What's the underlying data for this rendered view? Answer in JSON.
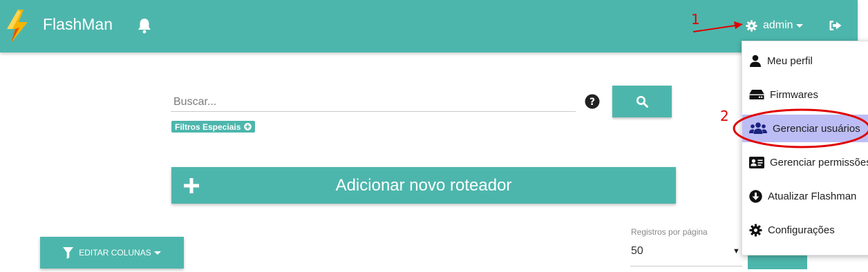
{
  "navbar": {
    "app_name": "FlashMan",
    "user_label": "admin",
    "bg_color": "#4db6ac"
  },
  "annotations": {
    "step1": "1",
    "step2": "2",
    "color": "#e00000"
  },
  "search": {
    "placeholder": "Buscar...",
    "special_filters_label": "Filtros Especiais"
  },
  "actions": {
    "add_router_label": "Adicionar novo roteador",
    "edit_columns_label": "EDITAR COLUNAS"
  },
  "pagination": {
    "per_page_label": "Registros por página",
    "per_page_value": "50"
  },
  "user_dropdown": {
    "items": [
      {
        "label": "Meu perfil",
        "icon": "user-icon"
      },
      {
        "label": "Firmwares",
        "icon": "hdd-icon"
      },
      {
        "label": "Gerenciar usuários",
        "icon": "users-icon",
        "highlighted": true
      },
      {
        "label": "Gerenciar permissões",
        "icon": "id-card-icon"
      },
      {
        "label": "Atualizar Flashman",
        "icon": "arrow-circle-down-icon"
      },
      {
        "label": "Configurações",
        "icon": "gear-icon"
      }
    ]
  }
}
